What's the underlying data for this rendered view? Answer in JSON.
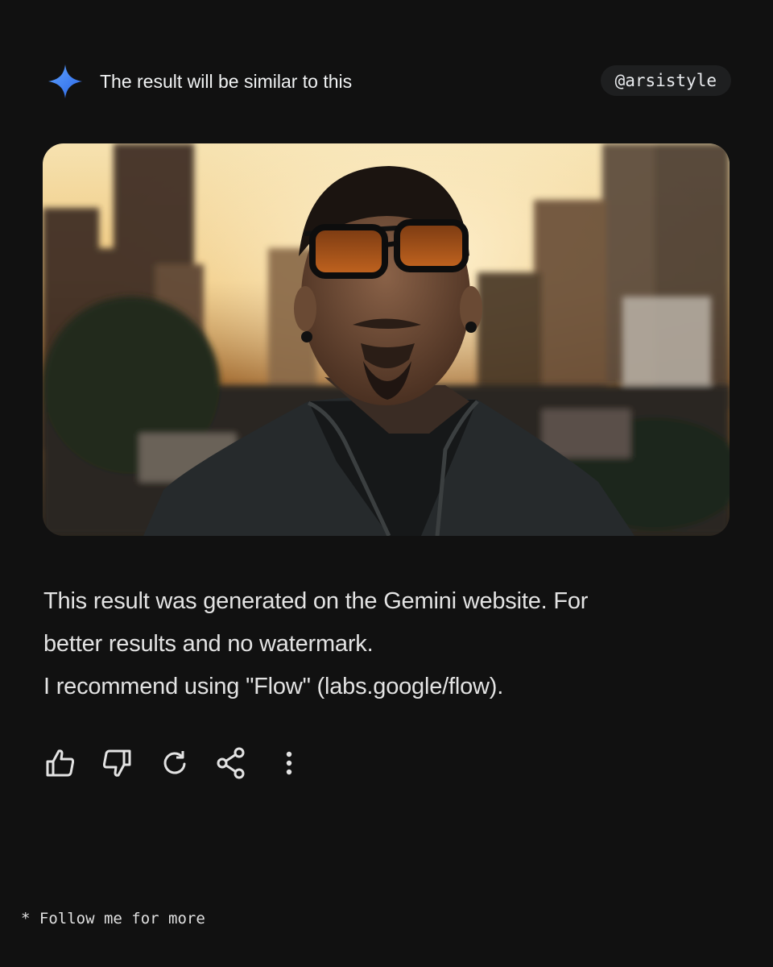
{
  "header": {
    "title": "The result will be similar to this",
    "handle": "@arsistyle",
    "icon": "gemini-sparkle-icon"
  },
  "image": {
    "icon": "generated-portrait-image"
  },
  "message": {
    "line1": "This result was generated on the Gemini website. For",
    "line2": "better results and no watermark.",
    "line3": "I recommend using \"Flow\" (labs.google/flow)."
  },
  "actions": [
    {
      "icon": "thumbs-up-icon"
    },
    {
      "icon": "thumbs-down-icon"
    },
    {
      "icon": "regenerate-icon"
    },
    {
      "icon": "share-icon"
    },
    {
      "icon": "more-vert-icon"
    }
  ],
  "footer": {
    "text": "* Follow me for more"
  },
  "colors": {
    "background": "#111111",
    "sparkle": "#4a8cf7",
    "text": "#e3e3e3",
    "handle_bg": "#1e1f20"
  }
}
